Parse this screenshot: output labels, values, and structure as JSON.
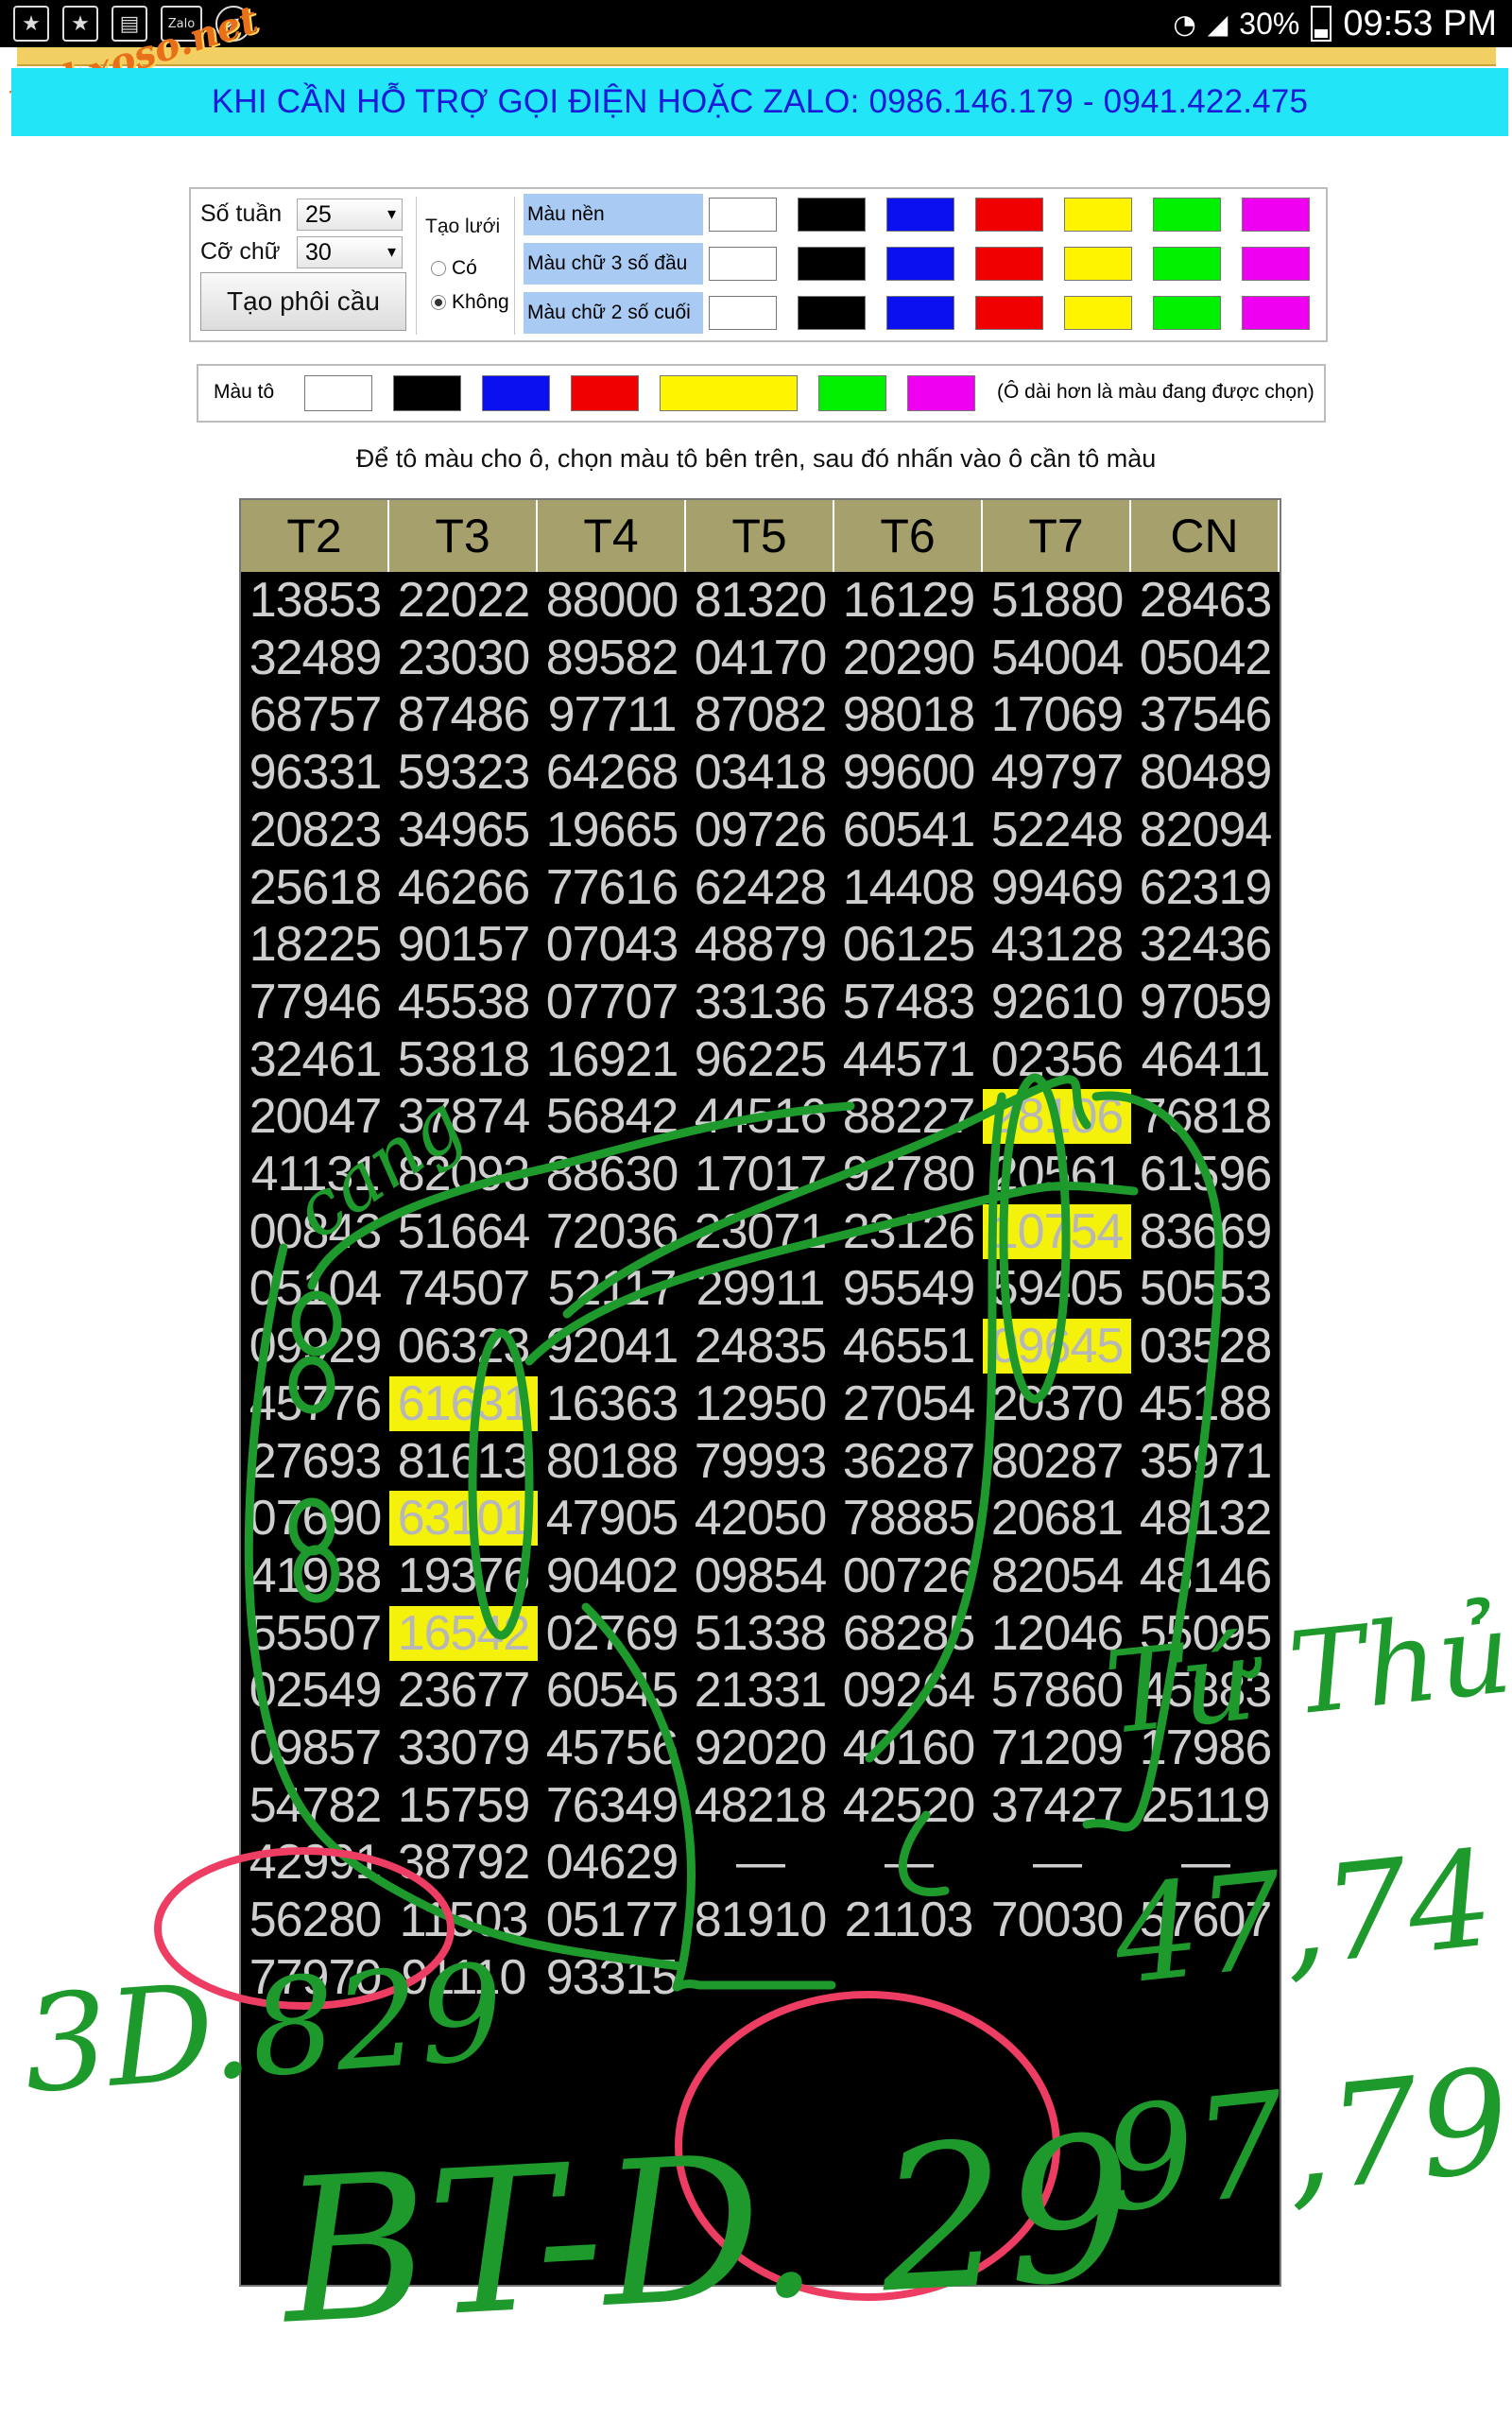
{
  "status_bar": {
    "left_icons": [
      "star-icon",
      "star-icon",
      "book-icon",
      "zalo-icon",
      "compass-icon"
    ],
    "zalo_label": "Zalo",
    "battery": "30%",
    "time": "09:53 PM"
  },
  "watermark": "webxoso.net",
  "banner": "KHI CẦN HỖ TRỢ GỌI ĐIỆN HOẶC ZALO: 0986.146.179 - 0941.422.475",
  "controls": {
    "weeks_label": "Số tuần",
    "weeks_value": "25",
    "font_label": "Cỡ chữ",
    "font_value": "30",
    "make_button": "Tạo phôi cầu",
    "grid_label": "Tạo lưới",
    "grid_yes": "Có",
    "grid_no": "Không",
    "grid_selected": "Không",
    "bg_color_label": "Màu nền",
    "first3_label": "Màu chữ 3 số đầu",
    "last2_label": "Màu chữ 2 số cuối",
    "palette": [
      "#ffffff",
      "#000000",
      "#0a10f0",
      "#f00000",
      "#fff400",
      "#00f000",
      "#f000f0"
    ]
  },
  "paint": {
    "label": "Màu tô",
    "hint": "(Ô dài hơn là màu đang được chọn)",
    "selected": "#fff400"
  },
  "instruction": "Để tô màu cho ô, chọn màu tô bên trên, sau đó nhấn vào ô cần tô màu",
  "table": {
    "headers": [
      "T2",
      "T3",
      "T4",
      "T5",
      "T6",
      "T7",
      "CN"
    ],
    "rows": [
      [
        "13853",
        "22022",
        "88000",
        "81320",
        "16129",
        "51880",
        "28463"
      ],
      [
        "32489",
        "23030",
        "89582",
        "04170",
        "20290",
        "54004",
        "05042"
      ],
      [
        "68757",
        "87486",
        "97711",
        "87082",
        "98018",
        "17069",
        "37546"
      ],
      [
        "96331",
        "59323",
        "64268",
        "03418",
        "99600",
        "49797",
        "80489"
      ],
      [
        "20823",
        "34965",
        "19665",
        "09726",
        "60541",
        "52248",
        "82094"
      ],
      [
        "25618",
        "46266",
        "77616",
        "62428",
        "14408",
        "99469",
        "62319"
      ],
      [
        "18225",
        "90157",
        "07043",
        "48879",
        "06125",
        "43128",
        "32436"
      ],
      [
        "77946",
        "45538",
        "07707",
        "33136",
        "57483",
        "92610",
        "97059"
      ],
      [
        "32461",
        "53818",
        "16921",
        "96225",
        "44571",
        "02356",
        "46411"
      ],
      [
        "20047",
        "37874",
        "56842",
        "44516",
        "88227",
        "28106",
        "76818"
      ],
      [
        "41131",
        "82093",
        "88630",
        "17017",
        "92780",
        "20561",
        "61596"
      ],
      [
        "00843",
        "51664",
        "72036",
        "23071",
        "23126",
        "10754",
        "83669"
      ],
      [
        "05104",
        "74507",
        "52117",
        "29911",
        "95549",
        "59405",
        "50553"
      ],
      [
        "09929",
        "06323",
        "92041",
        "24835",
        "46551",
        "09645",
        "03528"
      ],
      [
        "45776",
        "61631",
        "16363",
        "12950",
        "27054",
        "20370",
        "45188"
      ],
      [
        "27693",
        "81613",
        "80188",
        "79993",
        "36287",
        "80287",
        "35971"
      ],
      [
        "07690",
        "63101",
        "47905",
        "42050",
        "78885",
        "20681",
        "48132"
      ],
      [
        "41988",
        "19376",
        "90402",
        "09854",
        "00726",
        "82054",
        "48146"
      ],
      [
        "55507",
        "16542",
        "02769",
        "51338",
        "68285",
        "12046",
        "55095"
      ],
      [
        "02549",
        "23677",
        "60545",
        "21331",
        "09264",
        "57860",
        "45883"
      ],
      [
        "09857",
        "33079",
        "45756",
        "92020",
        "40160",
        "71209",
        "17986"
      ],
      [
        "54782",
        "15759",
        "76349",
        "48218",
        "42520",
        "37427",
        "25119"
      ],
      [
        "42991",
        "38792",
        "04629",
        "—",
        "—",
        "—",
        "—"
      ],
      [
        "56280",
        "11503",
        "05177",
        "81910",
        "21103",
        "70030",
        "57607"
      ],
      [
        "77970",
        "91110",
        "93315",
        "",
        "",
        "",
        ""
      ]
    ],
    "highlighted": [
      [
        9,
        5
      ],
      [
        11,
        5
      ],
      [
        13,
        5
      ],
      [
        14,
        1
      ],
      [
        16,
        1
      ],
      [
        18,
        1
      ]
    ]
  },
  "annotations": {
    "left_word": "cang",
    "right_text": "Tứ Thủ",
    "right_pair": "47,74",
    "right_pair2": "97,79",
    "bottom_left": "3D.829",
    "bottom_main": "BT-D. 29"
  }
}
